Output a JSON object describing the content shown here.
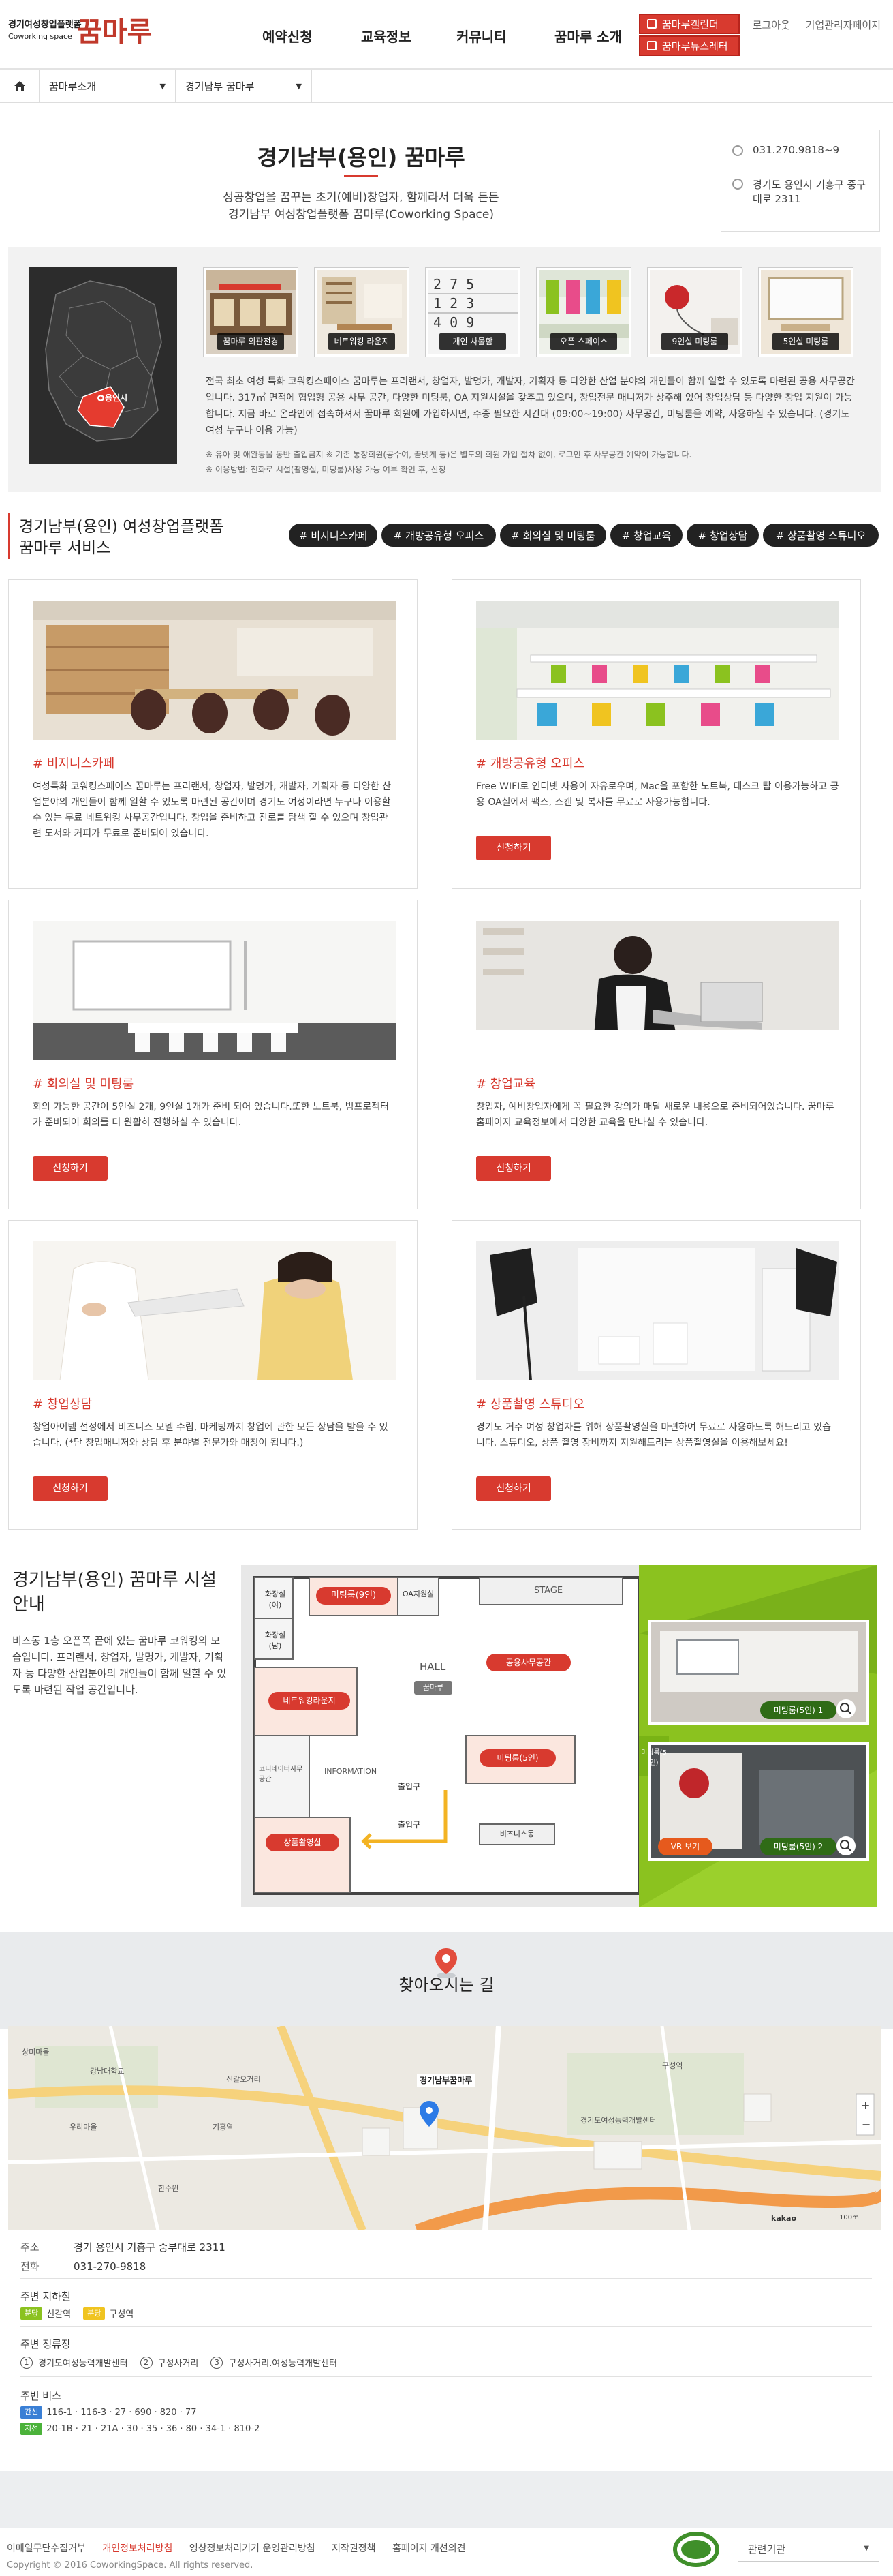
{
  "header": {
    "logo_small_line1": "경기여성창업플랫폼",
    "logo_small_line2": "Coworking space",
    "logo_big": "꿈마루",
    "top_links": [
      "로그아웃",
      "기업관리자페이지"
    ],
    "nav": [
      "예약신청",
      "교육정보",
      "커뮤니티",
      "꿈마루 소개"
    ],
    "quick": [
      "꿈마루캘린더",
      "꿈마루뉴스레터"
    ]
  },
  "breadcrumb": {
    "level1": "꿈마루소개",
    "level2": "경기남부 꿈마루"
  },
  "hero": {
    "title": "경기남부(용인) 꿈마루",
    "desc_line1": "성공창업을 꿈꾸는 초기(예비)창업자, 함께라서 더욱 든든",
    "desc_line2": "경기남부 여성창업플랫폼 꿈마루(Coworking Space)"
  },
  "contact": {
    "phone": "031.270.9818~9",
    "address": "경기도 용인시 기흥구 중구대로 2311"
  },
  "intro": {
    "map_label": "용인시",
    "thumbs": [
      "꿈마루 외관전경",
      "네트워킹 라운지",
      "개인 사물함",
      "오픈 스페이스",
      "9인실 미팅룸",
      "5인실 미팅룸"
    ],
    "text": "전국 최초 여성 특화 코워킹스페이스 꿈마루는 프리랜서, 창업자, 발명가, 개발자, 기획자 등 다양한 산업 분야의 개인들이 함께 일할 수 있도록 마련된 공용 사무공간입니다. 317㎡ 면적에 협업형 공용 사무 공간, 다양한 미팅룸, OA 지원시설을 갖추고 있으며, 창업전문 매니저가 상주해 있어 창업상담 등 다양한 창업 지원이 가능합니다. 지금 바로 온라인에 접속하셔서 꿈마루 회원에 가입하시면, 주중 필요한 시간대 (09:00~19:00) 사무공간, 미팅룸을 예약, 사용하실 수 있습니다. (경기도 여성 누구나 이용 가능)",
    "note1": "※ 유아 및 애완동물 동반 출입금지   ※ 기존 통장회원(공수여, 꿈넷게 등)은 별도의 회원 가입 절차 없이, 로그인 후 사무공간 예약이 가능합니다.",
    "note2": "※ 이용방법: 전화로 시설(촬영실, 미팅룸)사용 가능 여부 확인 후, 신청"
  },
  "services": {
    "title_line1": "경기남부(용인) 여성창업플랫폼",
    "title_line2": "꿈마루 서비스",
    "tags": [
      "# 비지니스카페",
      "# 개방공유형 오피스",
      "# 회의실 및 미팅룸",
      "# 창업교육",
      "# 창업상담",
      "# 상품촬영 스튜디오"
    ],
    "apply_label": "신청하기",
    "cards": [
      {
        "title": "# 비지니스카페",
        "desc": "여성특화 코워킹스페이스 꿈마루는 프리랜서, 창업자, 발명가, 개발자, 기획자 등 다양한 산업분야의 개인들이 함께 일할 수 있도록 마련된 공간이며 경기도 여성이라면 누구나 이용할 수 있는 무료 네트워킹 사무공간입니다. 창업을 준비하고 진로를 탐색 할 수 있으며 창업관련 도서와 커피가 무료로 준비되어 있습니다."
      },
      {
        "title": "# 개방공유형 오피스",
        "desc": "Free WIFI로 인터넷 사용이 자유로우며, Mac을 포함한 노트북, 데스크 탑 이용가능하고 공용 OA실에서 팩스, 스캔 및 복사를 무료로 사용가능합니다."
      },
      {
        "title": "# 회의실 및 미팅룸",
        "desc": "회의 가능한 공간이 5인실 2개, 9인실 1개가 준비 되어 있습니다.또한 노트북, 빔프로젝터가 준비되어 회의를 더 원활히 진행하실 수 있습니다."
      },
      {
        "title": "# 창업교육",
        "desc": "창업자, 예비창업자에게 꼭 필요한 강의가 매달 새로운 내용으로 준비되어있습니다. 꿈마루 홈페이지 교육정보에서 다양한 교육을 만나실 수 있습니다."
      },
      {
        "title": "# 창업상담",
        "desc": "창업아이템 선정에서 비즈니스 모델 수립, 마케팅까지 창업에 관한 모든 상담을 받을 수 있습니다. (*단 창업매니저와 상담 후 분야별 전문가와 매칭이 됩니다.)"
      },
      {
        "title": "# 상품촬영 스튜디오",
        "desc": "경기도 거주 여성 창업자를 위해 상품촬영실을 마련하여 무료로 사용하도록 해드리고 있습니다. 스튜디오, 상품 촬영 장비까지 지원해드리는 상품촬영실을 이용해보세요!"
      }
    ]
  },
  "floor": {
    "title": "경기남부(용인) 꿈마루 시설 안내",
    "desc": "비즈동 1층 오픈폭 끝에 있는 꿈마루 코워킹의 모습입니다. 프리랜서, 창업자, 발명가, 개발자, 기획자 등 다양한 산업분야의 개인들이 함께 일할 수 있도록 마련된 작업 공간입니다.",
    "rooms": [
      "화장실(여)",
      "화장실(남)",
      "미팅룸(9인)",
      "OA지원실",
      "STAGE",
      "HALL",
      "꿈마루",
      "네트워킹라운지",
      "공용사무공간",
      "코디네이터사무공간",
      "INFORMATION",
      "출입구",
      "미팅룸(5인)",
      "상품촬영실",
      "비즈니스동"
    ],
    "side_label": "미팅룸(5인)",
    "photo_labels": [
      "미팅룸(5인) 1",
      "미팅룸(5인) 2"
    ],
    "vr_label": "VR 보기"
  },
  "directions": {
    "title": "찾아오시는 길",
    "map_labels": [
      "경기남부꿈마루",
      "상미마을",
      "강남대학교",
      "기흥역",
      "한수원",
      "우리마을",
      "신갈오거리",
      "구성역",
      "경기도여성능력개발센터",
      "kakao",
      "100m"
    ],
    "addr_label": "주소",
    "addr_value": "경기 용인시 기흥구 중부대로 2311",
    "tel_label": "전화",
    "tel_value": "031-270-9818",
    "subway_label": "주변 지하철",
    "subway": [
      "신갈역",
      "구성역"
    ],
    "bus_stop_label": "주변 정류장",
    "bus_stops": [
      "경기도여성능력개발센터",
      "구성사거리",
      "구성사거리.여성능력개발센터"
    ],
    "bus_label": "주변 버스",
    "bus_lines": [
      {
        "type": "간선",
        "routes": "116-1 · 116-3 · 27 · 690 · 820 · 77"
      },
      {
        "type": "지선",
        "routes": "20-1B · 21 · 21A · 30 · 35 · 36 · 80 · 34-1 · 810-2"
      }
    ]
  },
  "footer": {
    "links": [
      "이메일무단수집거부",
      "개인정보처리방침",
      "영상정보처리기기 운영관리방침",
      "저작권정책",
      "홈페이지 개선의견"
    ],
    "copyright": "Copyright © 2016 CoworkingSpace. All rights reserved.",
    "related": "관련기관"
  },
  "colors": {
    "accent": "#d83a2f",
    "dark": "#222222",
    "green": "#8bc21f"
  }
}
